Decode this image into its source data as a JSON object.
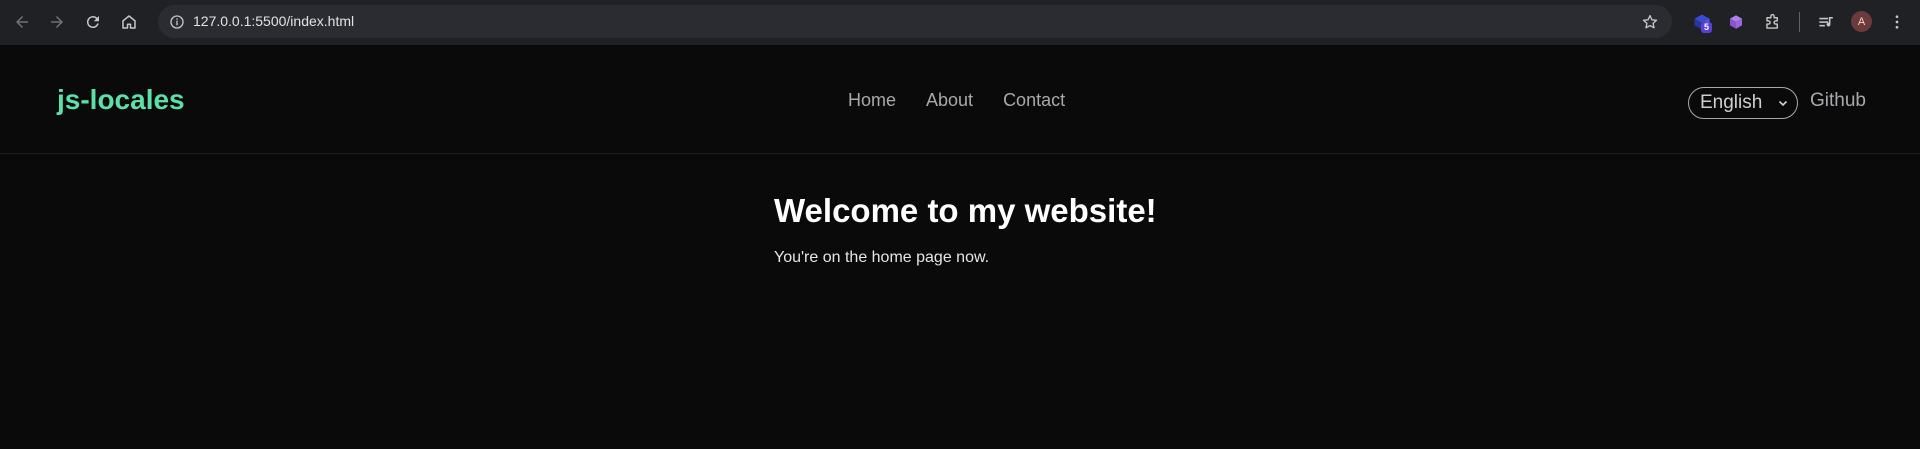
{
  "browser": {
    "url": "127.0.0.1:5500/index.html",
    "extension_badge": "5",
    "profile_initial": "A",
    "icons": {
      "back": "back-arrow-icon",
      "forward": "forward-arrow-icon",
      "reload": "reload-icon",
      "home": "home-icon",
      "site_info": "info-icon",
      "bookmark": "star-icon",
      "extensions": "puzzle-icon",
      "media": "media-controls-icon",
      "menu": "kebab-menu-icon"
    }
  },
  "header": {
    "brand": "js-locales",
    "nav": [
      {
        "label": "Home"
      },
      {
        "label": "About"
      },
      {
        "label": "Contact"
      }
    ],
    "language": "English",
    "github": "Github"
  },
  "main": {
    "title": "Welcome to my website!",
    "text": "You're on the home page now."
  },
  "colors": {
    "brand": "#5de0a8",
    "background": "#0a0a0b",
    "chrome": "#202124"
  }
}
